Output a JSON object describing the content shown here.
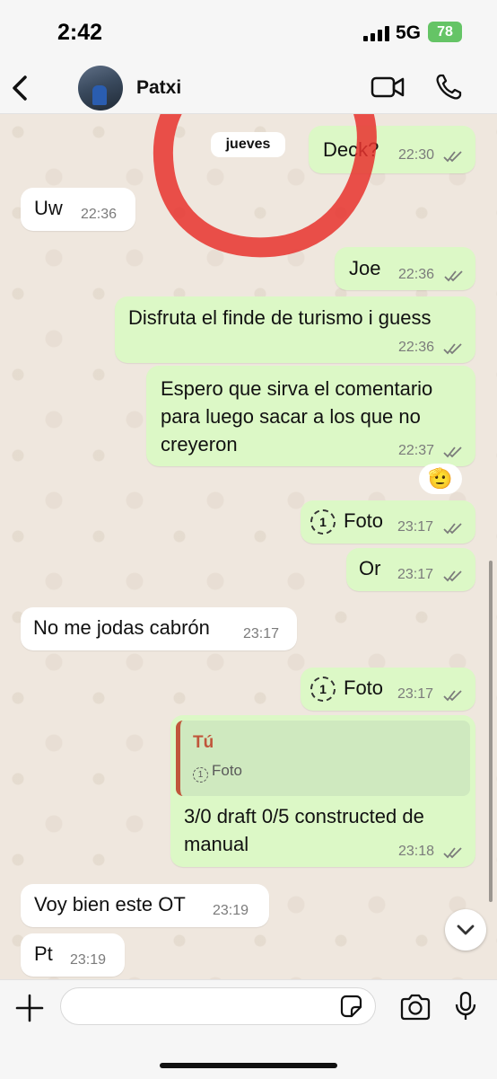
{
  "status_bar": {
    "time": "2:42",
    "network": "5G",
    "battery": "78"
  },
  "header": {
    "contact_name": "Patxi"
  },
  "chat": {
    "date_pill": "jueves",
    "messages": [
      {
        "dir": "out",
        "text": "Deck?",
        "time": "22:30",
        "read": true
      },
      {
        "dir": "in",
        "text": "Uw",
        "time": "22:36"
      },
      {
        "dir": "out",
        "text": "Joe",
        "time": "22:36",
        "read": true
      },
      {
        "dir": "out",
        "text": "Disfruta el finde de turismo i guess",
        "time": "22:36",
        "read": true
      },
      {
        "dir": "out",
        "lines": [
          "Espero que sirva el comentario",
          "para luego sacar a los que no",
          "creyeron"
        ],
        "time": "22:37",
        "read": true
      },
      {
        "dir": "out",
        "text": "Foto",
        "time": "23:17",
        "read": true,
        "view_once": "1"
      },
      {
        "dir": "out",
        "text": "Or",
        "time": "23:17",
        "read": true
      },
      {
        "dir": "in",
        "text": "No me jodas cabrón",
        "time": "23:17"
      },
      {
        "dir": "out",
        "text": "Foto",
        "time": "23:17",
        "read": true,
        "view_once": "1"
      },
      {
        "dir": "out",
        "reply": {
          "author": "Tú",
          "body": "Foto"
        },
        "lines": [
          "3/0 draft 0/5 constructed de",
          "manual"
        ],
        "time": "23:18",
        "read": true
      },
      {
        "dir": "in",
        "text": "Voy bien este OT",
        "time": "23:19"
      },
      {
        "dir": "in",
        "text": "Pt",
        "time": "23:19"
      }
    ],
    "reaction_emoji": "🫡"
  },
  "colors": {
    "incoming": "#ffffff",
    "outgoing": "#dcf8c6",
    "tick": "#7b7b7b",
    "annotation": "#e8332e"
  }
}
